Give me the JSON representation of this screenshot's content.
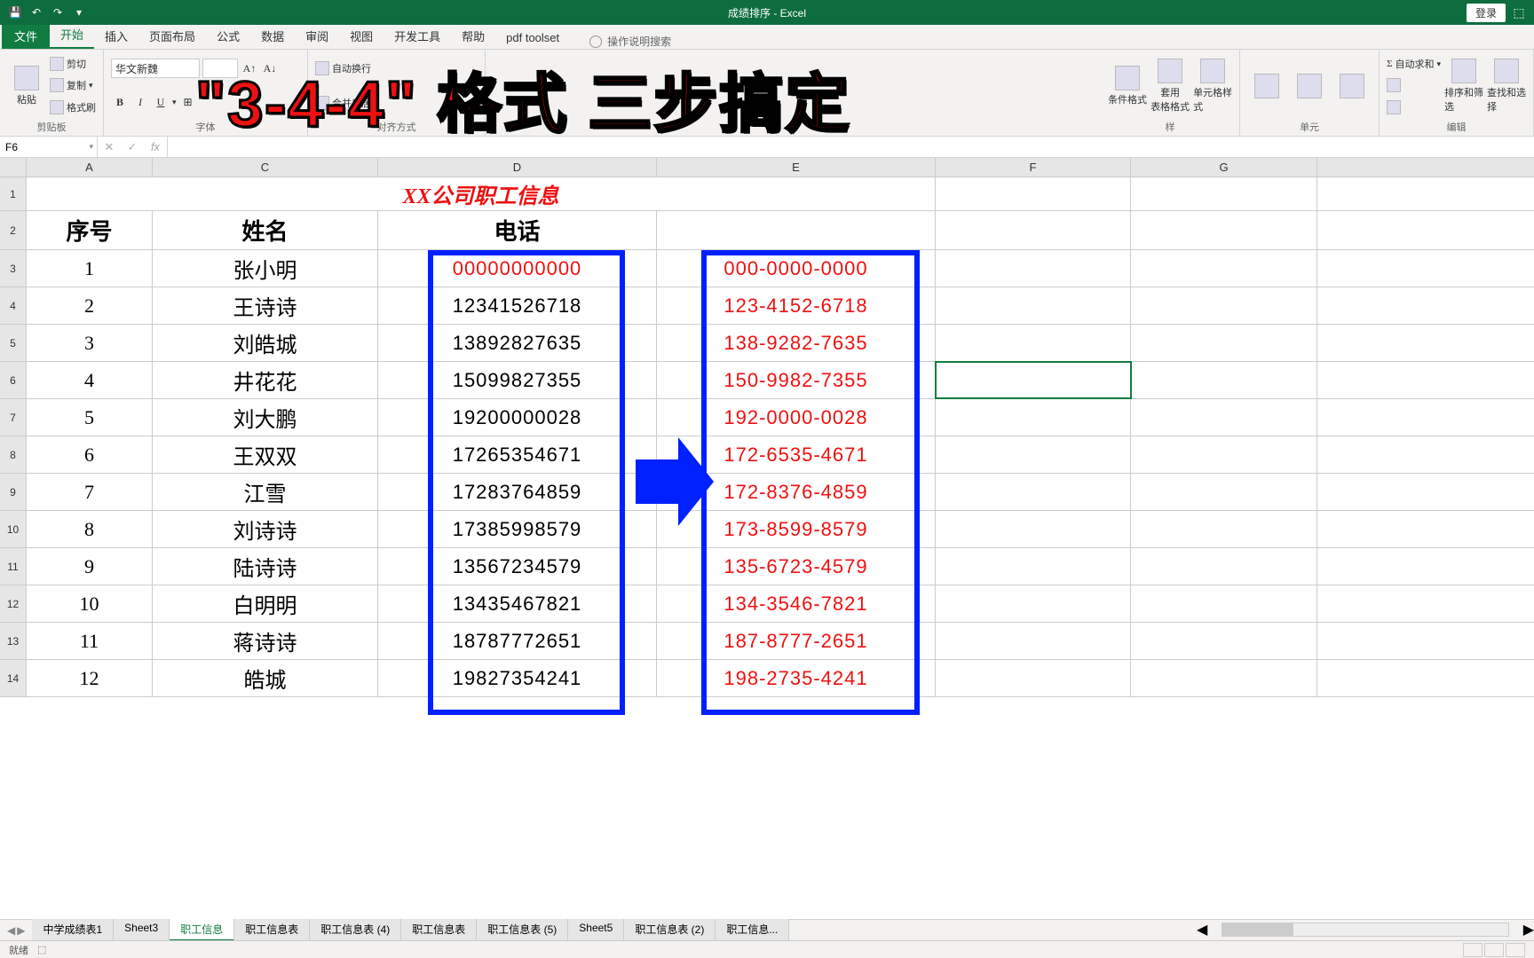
{
  "titlebar": {
    "title": "成绩排序 - Excel",
    "login": "登录"
  },
  "tabs": {
    "file": "文件",
    "items": [
      "开始",
      "插入",
      "页面布局",
      "公式",
      "数据",
      "审阅",
      "视图",
      "开发工具",
      "帮助",
      "pdf toolset"
    ],
    "active": "开始",
    "tellme": "操作说明搜索"
  },
  "ribbon": {
    "clipboard": {
      "paste": "粘贴",
      "cut": "剪切",
      "copy": "复制",
      "painter": "格式刷",
      "label": "剪贴板"
    },
    "font": {
      "name": "华文新魏",
      "size": "",
      "label": "字体"
    },
    "align": {
      "wrap": "自动换行",
      "merge": "合并后居",
      "label": "对齐方式"
    },
    "styles": {
      "cond": "条件格式",
      "table": "套用\n表格格式",
      "cell": "单元格样式",
      "label": "样"
    },
    "cells": {
      "label": "单元"
    },
    "editing": {
      "autosum": "自动求和",
      "sort": "排序和筛选",
      "find": "查找和选择",
      "label": "编辑"
    }
  },
  "overlay": "\"3-4-4\" 格式  三步搞定",
  "namebox": "F6",
  "formula": "",
  "columns": [
    "A",
    "C",
    "D",
    "E",
    "F",
    "G"
  ],
  "sheet": {
    "title": "XX公司职工信息",
    "headers": {
      "seq": "序号",
      "name": "姓名",
      "phone": "电话"
    },
    "rows": [
      {
        "n": "1",
        "name": "张小明",
        "phone": "00000000000",
        "fmt": "000-0000-0000"
      },
      {
        "n": "2",
        "name": "王诗诗",
        "phone": "12341526718",
        "fmt": "123-4152-6718"
      },
      {
        "n": "3",
        "name": "刘皓城",
        "phone": "13892827635",
        "fmt": "138-9282-7635"
      },
      {
        "n": "4",
        "name": "井花花",
        "phone": "15099827355",
        "fmt": "150-9982-7355"
      },
      {
        "n": "5",
        "name": "刘大鹏",
        "phone": "19200000028",
        "fmt": "192-0000-0028"
      },
      {
        "n": "6",
        "name": "王双双",
        "phone": "17265354671",
        "fmt": "172-6535-4671"
      },
      {
        "n": "7",
        "name": "江雪",
        "phone": "17283764859",
        "fmt": "172-8376-4859"
      },
      {
        "n": "8",
        "name": "刘诗诗",
        "phone": "17385998579",
        "fmt": "173-8599-8579"
      },
      {
        "n": "9",
        "name": "陆诗诗",
        "phone": "13567234579",
        "fmt": "135-6723-4579"
      },
      {
        "n": "10",
        "name": "白明明",
        "phone": "13435467821",
        "fmt": "134-3546-7821"
      },
      {
        "n": "11",
        "name": "蒋诗诗",
        "phone": "18787772651",
        "fmt": "187-8777-2651"
      },
      {
        "n": "12",
        "name": "皓城",
        "phone": "19827354241",
        "fmt": "198-2735-4241"
      }
    ]
  },
  "sheettabs": [
    "中学成绩表1",
    "Sheet3",
    "职工信息",
    "职工信息表",
    "职工信息表 (4)",
    "职工信息表",
    "职工信息表 (5)",
    "Sheet5",
    "职工信息表 (2)",
    "职工信息..."
  ],
  "sheettab_active": "职工信息",
  "status": {
    "ready": "就绪"
  }
}
